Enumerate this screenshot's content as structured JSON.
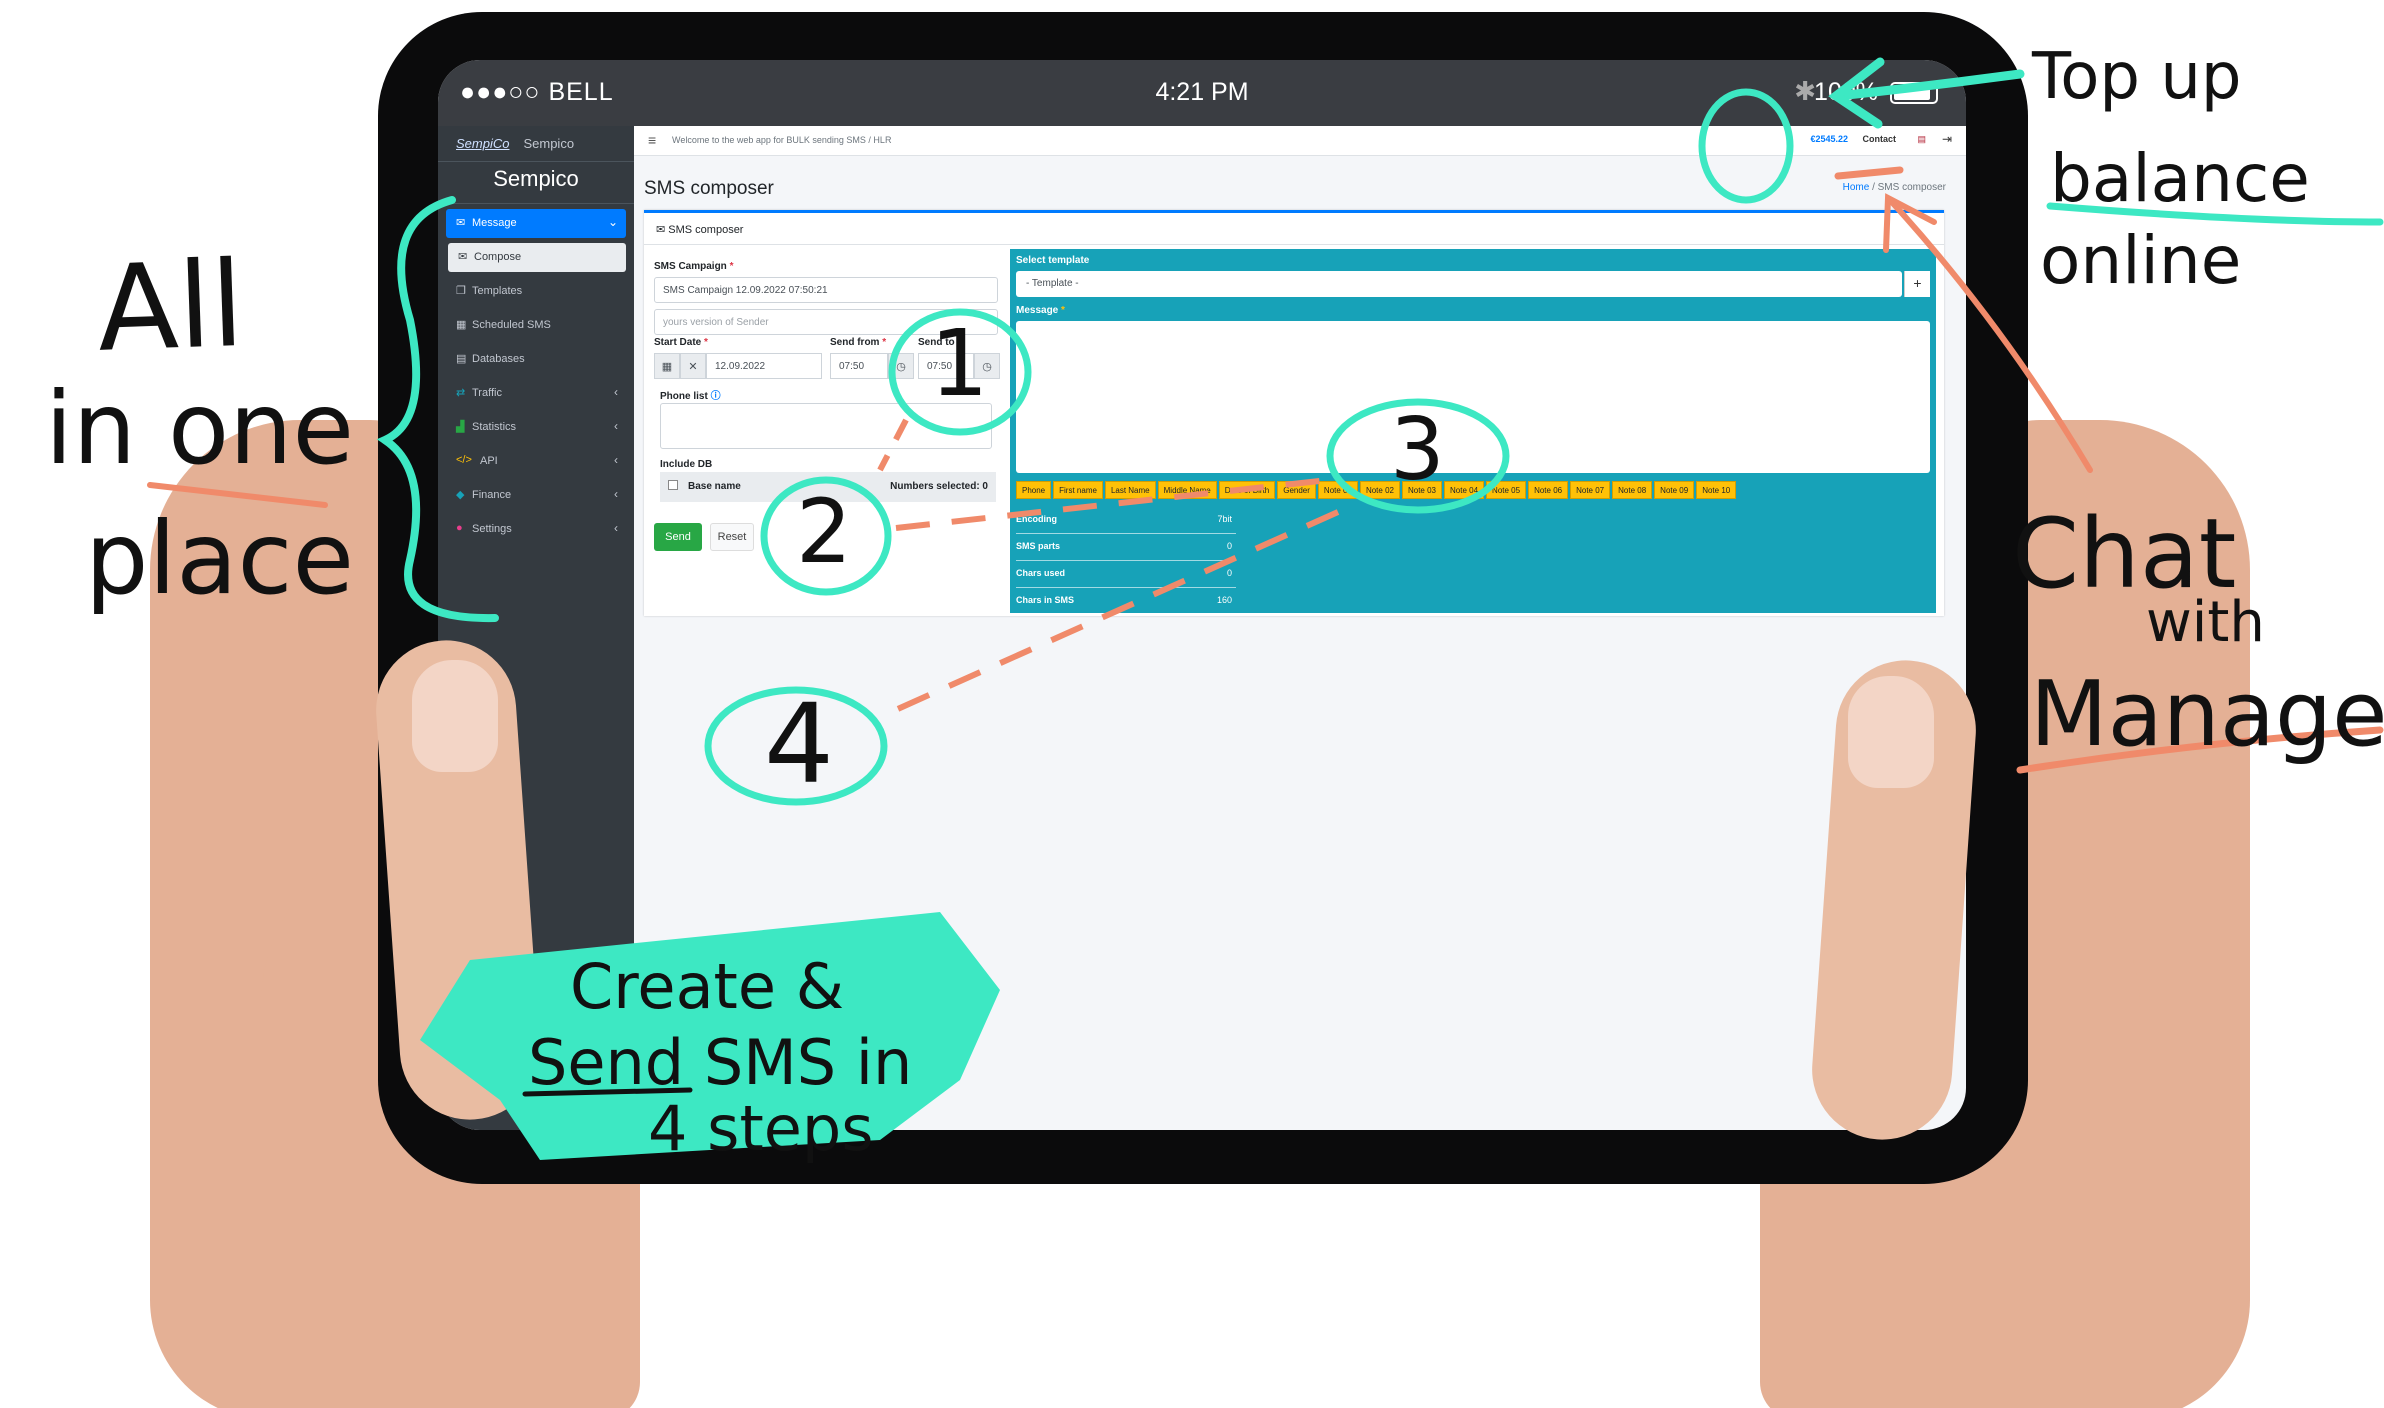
{
  "status": {
    "carrier": "●●●○○ BELL",
    "time": "4:21 PM",
    "battery": "100%"
  },
  "sidebar": {
    "logo": "SempiCo",
    "brand": "Sempico",
    "user": "Sempico",
    "items": [
      {
        "label": "Message",
        "icon": "envelope-icon",
        "state": "active"
      },
      {
        "label": "Compose",
        "icon": "envelope-icon",
        "state": "current"
      },
      {
        "label": "Templates",
        "icon": "copy-icon"
      },
      {
        "label": "Scheduled SMS",
        "icon": "calendar-icon"
      },
      {
        "label": "Databases",
        "icon": "database-icon"
      },
      {
        "label": "Traffic",
        "icon": "traffic-icon"
      },
      {
        "label": "Statistics",
        "icon": "chart-icon"
      },
      {
        "label": "API",
        "icon": "code-icon"
      },
      {
        "label": "Finance",
        "icon": "finance-icon"
      },
      {
        "label": "Settings",
        "icon": "users-icon"
      }
    ]
  },
  "topbar": {
    "welcome": "Welcome to the web app for BULK sending SMS / HLR",
    "balance": "€2545.22",
    "contact": "Contact"
  },
  "page": {
    "title": "SMS composer",
    "breadcrumb_home": "Home",
    "breadcrumb_current": "SMS composer"
  },
  "form": {
    "card_title": "SMS composer",
    "campaign_label": "SMS Campaign",
    "campaign_value": "SMS Campaign 12.09.2022 07:50:21",
    "sender_placeholder": "yours version of Sender",
    "start_date_label": "Start Date",
    "start_date_value": "12.09.2022",
    "send_from_label": "Send from",
    "send_from_value": "07:50",
    "send_to_label": "Send to",
    "send_to_value": "07:50",
    "phone_list_label": "Phone list",
    "include_db_label": "Include DB",
    "base_name_header": "Base name",
    "numbers_selected": "Numbers selected: 0",
    "send_label": "Send",
    "reset_label": "Reset"
  },
  "template_panel": {
    "select_label": "Select template",
    "select_placeholder": "- Template -",
    "message_label": "Message",
    "variables": [
      "Phone",
      "First name",
      "Last Name",
      "Middle Name",
      "Date of Birth",
      "Gender",
      "Note 01",
      "Note 02",
      "Note 03",
      "Note 04",
      "Note 05",
      "Note 06",
      "Note 07",
      "Note 08",
      "Note 09",
      "Note 10"
    ],
    "stats": [
      {
        "label": "Encoding",
        "value": "7bit"
      },
      {
        "label": "SMS parts",
        "value": "0"
      },
      {
        "label": "Chars used",
        "value": "0"
      },
      {
        "label": "Chars in SMS",
        "value": "160"
      }
    ]
  },
  "annotations": {
    "all_in_one": [
      "All",
      "in one",
      "place"
    ],
    "top_up": [
      "Top up",
      "balance",
      "online"
    ],
    "chat": [
      "Chat",
      "with",
      "Manager"
    ],
    "create": [
      "Create &",
      "Send SMS in",
      "4 steps"
    ],
    "steps": [
      "1",
      "2",
      "3",
      "4"
    ],
    "accent_color": "#3de8c3",
    "underline_color": "#f08a6a"
  }
}
